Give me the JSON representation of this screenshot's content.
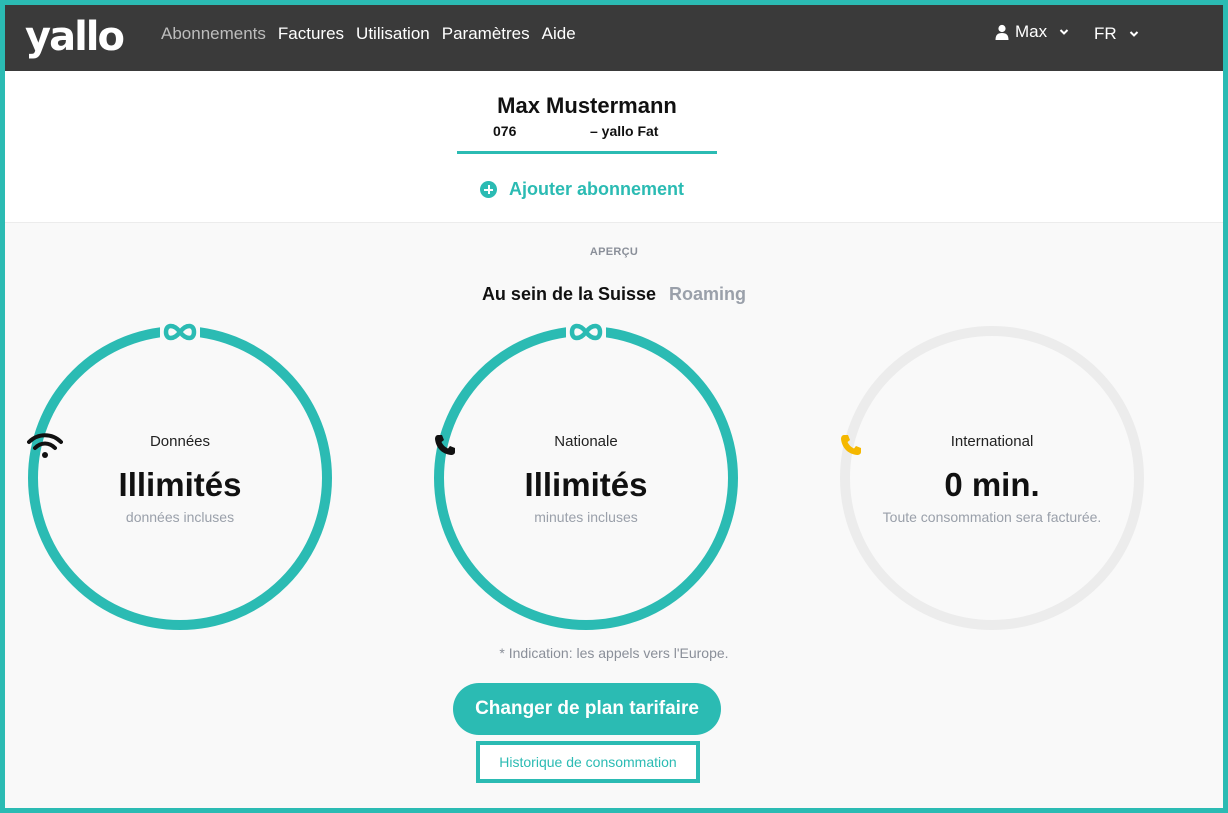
{
  "header": {
    "logo": "yallo",
    "nav": [
      {
        "label": "Abonnements",
        "active": true
      },
      {
        "label": "Factures",
        "active": false
      },
      {
        "label": "Utilisation",
        "active": false
      },
      {
        "label": "Paramètres",
        "active": false
      },
      {
        "label": "Aide",
        "active": false
      }
    ],
    "user_label": "Max",
    "language": "FR"
  },
  "subscriber": {
    "name": "Max Mustermann",
    "number": "076",
    "plan": "– yallo Fat",
    "add_subscription_label": "Ajouter abonnement"
  },
  "overview": {
    "label": "APERÇU",
    "tabs": [
      {
        "label": "Au sein de la Suisse",
        "active": true
      },
      {
        "label": "Roaming",
        "active": false
      }
    ],
    "gauges": [
      {
        "type": "Données",
        "icon": "wifi-icon",
        "value": "Illimités",
        "note": "données incluses",
        "unlimited": true,
        "fill_fraction": 1.0,
        "color": "#2bbbb3"
      },
      {
        "type": "Nationale",
        "icon": "phone-icon",
        "value": "Illimités",
        "note": "minutes incluses",
        "unlimited": true,
        "fill_fraction": 1.0,
        "color": "#2bbbb3"
      },
      {
        "type": "International",
        "icon": "phone-icon",
        "value": "0 min.",
        "note": "Toute consommation sera facturée.",
        "unlimited": false,
        "fill_fraction": 0.0,
        "color": "#f5b800"
      }
    ],
    "indication": "* Indication: les appels vers l'Europe.",
    "change_plan_label": "Changer de plan tarifaire",
    "history_label": "Historique de consommation"
  },
  "colors": {
    "accent": "#2bbbb3",
    "header_bg": "#3a3a3a",
    "track": "#ececec",
    "international_icon": "#f5b800"
  }
}
